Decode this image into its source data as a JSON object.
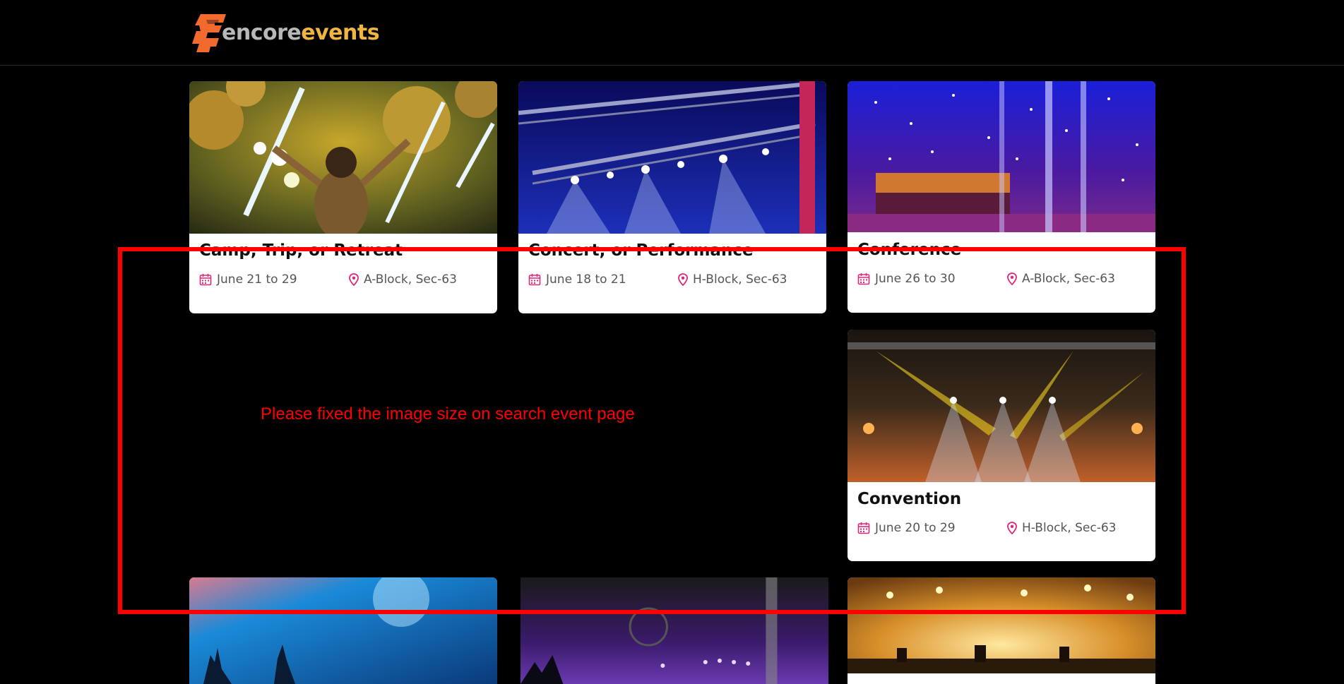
{
  "header": {
    "logo_word1": "encore",
    "logo_word2": "events"
  },
  "events": [
    {
      "title": "Camp, Trip, or Retreat",
      "date": "June 21 to 29",
      "location": "A-Block, Sec-63",
      "image": "disco-party-photo"
    },
    {
      "title": "Concert, or Performance",
      "date": "June 18 to 21",
      "location": "H-Block, Sec-63",
      "image": "stage-lighting-truss-photo"
    },
    {
      "title": "Conference",
      "date": "June 26 to 30",
      "location": "A-Block, Sec-63",
      "image": "fairy-lights-hall-photo"
    },
    {
      "title": "Convention",
      "date": "June 20 to 29",
      "location": "H-Block, Sec-63",
      "image": "concert-stage-beams-photo"
    },
    {
      "title": "",
      "date": "",
      "location": "",
      "image": "crowd-blue-lights-photo"
    },
    {
      "title": "",
      "date": "",
      "location": "",
      "image": "purple-stage-crowd-photo"
    },
    {
      "title": "",
      "date": "",
      "location": "",
      "image": "orange-stage-band-photo"
    }
  ],
  "annotation": {
    "note": "Please fixed the image size on search event page",
    "color": "#ff0000"
  },
  "colors": {
    "accent_pink": "#e0267a",
    "background": "#000000",
    "logo_orange": "#f26a2e",
    "logo_gold": "#f0b541"
  },
  "icons": {
    "date": "calendar-icon",
    "location": "map-pin-icon"
  }
}
